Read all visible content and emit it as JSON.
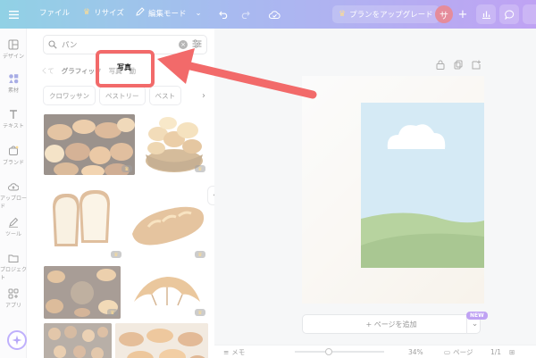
{
  "topbar": {
    "file_label": "ファイル",
    "resize_label": "リサイズ",
    "edit_mode_label": "編集モード",
    "upgrade_label": "プランをアップグレード",
    "avatar_initial": "サ",
    "add_label": "+"
  },
  "siderail": {
    "items": [
      {
        "label": "デザイン",
        "icon": "layout-icon"
      },
      {
        "label": "素材",
        "icon": "elements-icon"
      },
      {
        "label": "テキスト",
        "icon": "text-icon"
      },
      {
        "label": "ブランド",
        "icon": "brand-icon"
      },
      {
        "label": "アップロード",
        "icon": "upload-icon"
      },
      {
        "label": "ツール",
        "icon": "draw-icon"
      },
      {
        "label": "プロジェクト",
        "icon": "folder-icon"
      },
      {
        "label": "アプリ",
        "icon": "apps-icon"
      }
    ]
  },
  "panel": {
    "search_value": "パン",
    "tabs": [
      "くて",
      "グラフィック",
      "写真",
      "動"
    ],
    "chips": [
      "クロワッサン",
      "ペストリー",
      "ベスト"
    ]
  },
  "annotation": {
    "highlight_label": "写真"
  },
  "canvas": {
    "add_page_label": "+ ページを追加",
    "new_badge": "NEW"
  },
  "bottombar": {
    "notes_label": "メモ",
    "zoom": "34%",
    "pages_label": "ページ",
    "page_count": "1/1"
  },
  "colors": {
    "topbar_start": "#1aa0c8",
    "topbar_end": "#7a3ee6",
    "highlight": "#f26a6a",
    "avatar": "#c8102e"
  }
}
